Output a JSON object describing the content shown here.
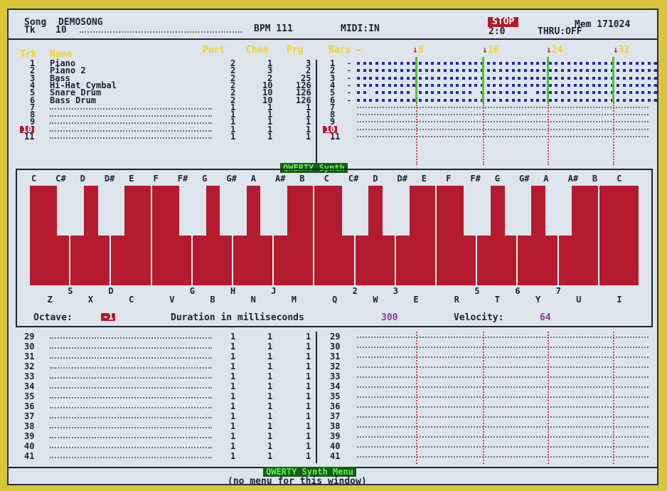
{
  "header": {
    "song_label": "Song",
    "song_name": "DEMOSONG",
    "track_label": "Tk",
    "track_num": "10",
    "bpm": "BPM 111",
    "midi": "MIDI:IN",
    "status": "STOP",
    "position": "2:0",
    "thru": "THRU:OFF",
    "mem": "Mem 171024"
  },
  "track_table": {
    "col_trk": "Trk",
    "col_name": "Name",
    "col_port": "Port",
    "col_chan": "Chan",
    "col_prg": "Prg",
    "col_bars": "Bars",
    "bar_markers": [
      "8",
      "16",
      "24",
      "32"
    ],
    "rows": [
      {
        "n": "1",
        "name": "Piano",
        "port": "2",
        "chan": "1",
        "prg": "3"
      },
      {
        "n": "2",
        "name": "Piano 2",
        "port": "2",
        "chan": "3",
        "prg": "2"
      },
      {
        "n": "3",
        "name": "Bass",
        "port": "2",
        "chan": "2",
        "prg": "25"
      },
      {
        "n": "4",
        "name": "Hi-Hat Cymbal",
        "port": "2",
        "chan": "10",
        "prg": "126"
      },
      {
        "n": "5",
        "name": "Snare Drum",
        "port": "2",
        "chan": "10",
        "prg": "126"
      },
      {
        "n": "6",
        "name": "Bass Drum",
        "port": "2",
        "chan": "10",
        "prg": "126"
      },
      {
        "n": "7",
        "name": "",
        "port": "1",
        "chan": "1",
        "prg": "1"
      },
      {
        "n": "8",
        "name": "",
        "port": "1",
        "chan": "1",
        "prg": "1"
      },
      {
        "n": "9",
        "name": "",
        "port": "1",
        "chan": "1",
        "prg": "1"
      },
      {
        "n": "10",
        "name": "",
        "port": "1",
        "chan": "1",
        "prg": "1"
      },
      {
        "n": "11",
        "name": "",
        "port": "1",
        "chan": "1",
        "prg": "1"
      }
    ],
    "selected_track": "10"
  },
  "synth": {
    "title": "QWERTY Synth",
    "note_labels": [
      "C",
      "C#",
      "D",
      "D#",
      "E",
      "F",
      "F#",
      "G",
      "G#",
      "A",
      "A#",
      "B",
      "C",
      "C#",
      "D",
      "D#",
      "E",
      "F",
      "F#",
      "G",
      "G#",
      "A",
      "A#",
      "B",
      "C"
    ],
    "upper_keys": [
      "S",
      "D",
      "G",
      "H",
      "J",
      "2",
      "3",
      "5",
      "6",
      "7"
    ],
    "lower_keys": [
      "Z",
      "X",
      "C",
      "V",
      "B",
      "N",
      "M",
      "Q",
      "W",
      "E",
      "R",
      "T",
      "Y",
      "U",
      "I"
    ],
    "octave_label": "Octave:",
    "octave_value": "-1",
    "duration_label": "Duration in milliseconds",
    "duration_value": "300",
    "velocity_label": "Velocity:",
    "velocity_value": "64"
  },
  "lower_tracks": [
    "29",
    "30",
    "31",
    "32",
    "33",
    "34",
    "35",
    "36",
    "37",
    "38",
    "39",
    "40",
    "41"
  ],
  "lower_values": {
    "port": "1",
    "chan": "1",
    "prg": "1"
  },
  "footer": {
    "menu_title": "QWERTY Synth Menu",
    "menu_note": "(no menu for this window)"
  },
  "colors": {
    "yellow": "#f2d31b",
    "red": "#b11c2e",
    "blue": "#1d2ea8",
    "green": "#56c02a",
    "magenta": "#8a3a9a"
  }
}
